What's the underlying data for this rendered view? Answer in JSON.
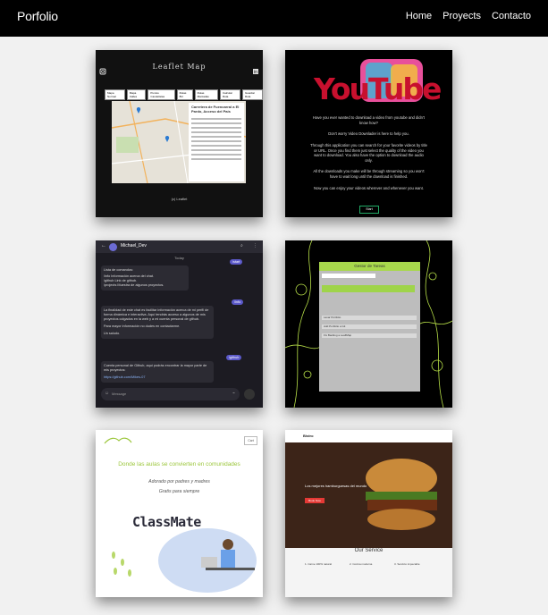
{
  "navbar": {
    "brand": "Porfolio",
    "links": [
      "Home",
      "Proyects",
      "Contacto"
    ]
  },
  "cards": {
    "leaflet": {
      "title": "Leaflet Map",
      "tabs": [
        "Mapa Normal",
        "Mapa Calles",
        "Puntos Candelistas",
        "Rutas BU",
        "Rutas Marcadas",
        "Calcular Ruta",
        "Guardar Ruta"
      ],
      "route_title": "Carretera de Fuencarral a El Pardo, Acceso del País",
      "footer": "(c) Leaflet"
    },
    "youtube": {
      "logo": "YouTube",
      "p1": "Have you ever wanted to download a video from youtube and didn't know how?",
      "p2": "Don't worry Video Downlader is here to help you.",
      "p3": "Through this application you can search for your favorite videos by title or URL. Once you find them just select the quality of the video you want to download. You also have the option to download the audio only.",
      "p4": "All the downloads you make will be through streaming so you won't have to wait long until the download is finished.",
      "p5": "Now you can enjoy your videos wherever and whenever you want.",
      "button": "Start"
    },
    "chat": {
      "name": "Michael_Dev",
      "day": "Today",
      "msg1_title": "Lista de comandos:",
      "msg1_info": "/info Información acerca del chat.",
      "msg1_github": "/github Link de github.",
      "msg1_proj": "/projects Muestra de algunos proyectos.",
      "me1": "/start",
      "me2": "/info",
      "msg2": "La finalidad de este chat es facilitar información acerca de mi perfil de forma dinámica e interactiva. Aquí tendrás acceso a algunos de mis proyectos colgados en la web y a mi cuenta personal de github.",
      "msg2b": "Para mayor información no dudes en contactarme.",
      "msg2c": "Un saludo.",
      "me3": "/github",
      "msg3": "Cuenta personal de Github, aquí podrás encontrar la mayor parte de mis proyectos:",
      "msg3_link": "https://github.com/Mikes-07",
      "input_placeholder": "Message"
    },
    "tasks": {
      "title": "Gestor de Tareas",
      "rows": [
        "Lavar Portfolio",
        "Add Portfolio a Git",
        "Fix Backlog a LeaflMap"
      ]
    },
    "classmate": {
      "cta": "Cart",
      "subtitle": "Donde las aulas se convierten en comunidades",
      "tagline1": "Adorado por padres y madres",
      "tagline2": "Gratis para siempre",
      "title": "ClassMate"
    },
    "burger": {
      "nav": "Bistro",
      "hero_text": "Los mejores hamburguesas del mundo",
      "hero_button": "Book Now",
      "section": "Our Service",
      "services": [
        "1. Carne 100% natural",
        "2. Cocina moderna",
        "3. Servicio impecable"
      ]
    }
  }
}
